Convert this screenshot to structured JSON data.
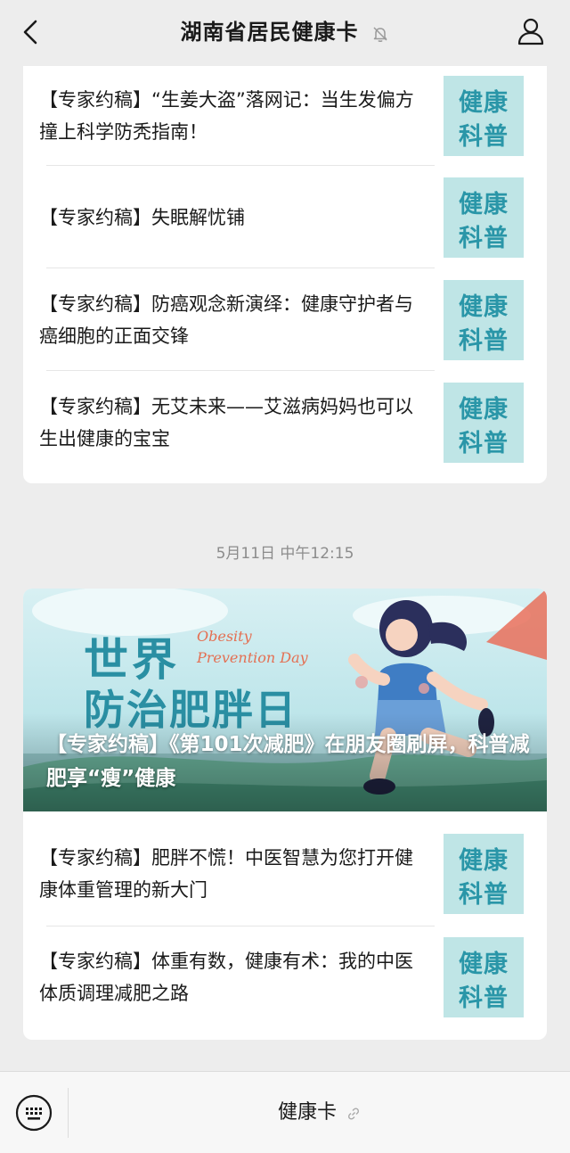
{
  "header": {
    "title": "湖南省居民健康卡",
    "back_icon": "chevron-left-icon",
    "mute_icon": "bell-off-icon",
    "profile_icon": "user-icon"
  },
  "feed": {
    "group1": {
      "articles": [
        {
          "title": "【专家约稿】“生姜大盗”落网记：当生发偏方撞上科学防秃指南！",
          "thumb": {
            "line1": "健康",
            "line2": "科普"
          }
        },
        {
          "title": "【专家约稿】失眠解忧铺",
          "thumb": {
            "line1": "健康",
            "line2": "科普"
          }
        },
        {
          "title": "【专家约稿】防癌观念新演绎：健康守护者与癌细胞的正面交锋",
          "thumb": {
            "line1": "健康",
            "line2": "科普"
          }
        },
        {
          "title": "【专家约稿】无艾未来——艾滋病妈妈也可以生出健康的宝宝",
          "thumb": {
            "line1": "健康",
            "line2": "科普"
          }
        }
      ]
    },
    "timestamp": "5月11日 中午12:15",
    "group2": {
      "banner": {
        "title": "【专家约稿】《第101次减肥》在朋友圈刷屏，科普减肥享“瘦”健康",
        "image_text_1": "世界",
        "image_text_2": "防治肥胖日",
        "image_text_en1": "Obesity",
        "image_text_en2": "Prevention Day"
      },
      "articles": [
        {
          "title": "【专家约稿】肥胖不慌！中医智慧为您打开健康体重管理的新大门",
          "thumb": {
            "line1": "健康",
            "line2": "科普"
          }
        },
        {
          "title": "【专家约稿】体重有数，健康有术：我的中医体质调理减肥之路",
          "thumb": {
            "line1": "健康",
            "line2": "科普"
          }
        }
      ]
    }
  },
  "bottom": {
    "keyboard_icon": "keyboard-icon",
    "menu_label": "健康卡",
    "link_icon": "link-icon"
  },
  "colors": {
    "background": "#ededed",
    "card": "#ffffff",
    "thumb_bg": "#bfe5e6",
    "thumb_text": "#2a96a8",
    "banner_title": "#2a8fa3"
  }
}
